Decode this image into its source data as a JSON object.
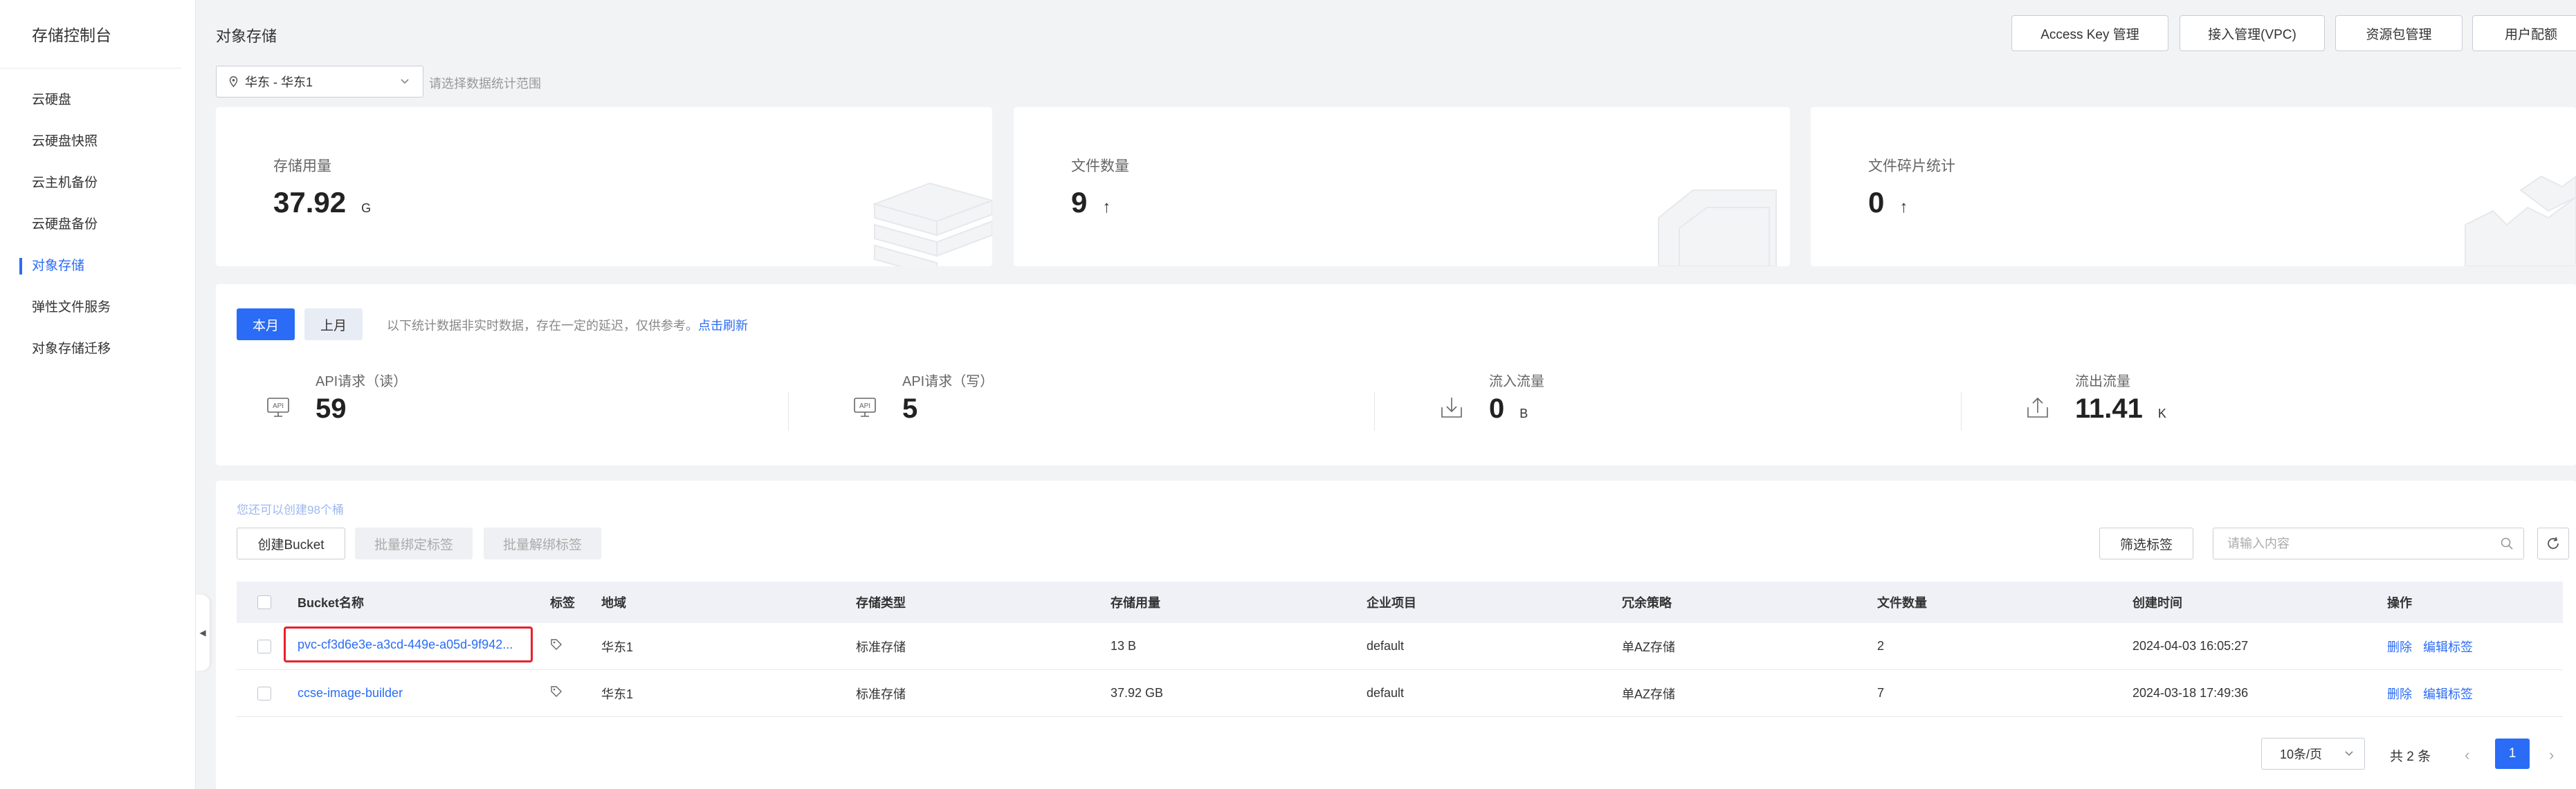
{
  "sidebar": {
    "title": "存储控制台",
    "items": [
      {
        "label": "云硬盘",
        "active": false
      },
      {
        "label": "云硬盘快照",
        "active": false
      },
      {
        "label": "云主机备份",
        "active": false
      },
      {
        "label": "云硬盘备份",
        "active": false
      },
      {
        "label": "对象存储",
        "active": true
      },
      {
        "label": "弹性文件服务",
        "active": false
      },
      {
        "label": "对象存储迁移",
        "active": false
      }
    ]
  },
  "header": {
    "title": "对象存储",
    "buttons": [
      "Access Key 管理",
      "接入管理(VPC)",
      "资源包管理",
      "用户配额"
    ]
  },
  "region": {
    "selected": "华东 - 华东1",
    "hint": "请选择数据统计范围"
  },
  "stats": [
    {
      "label": "存储用量",
      "value": "37.92",
      "unit": "G"
    },
    {
      "label": "文件数量",
      "value": "9",
      "unit": "↑"
    },
    {
      "label": "文件碎片统计",
      "value": "0",
      "unit": "↑"
    }
  ],
  "period": {
    "current": "本月",
    "previous": "上月",
    "notice": "以下统计数据非实时数据，存在一定的延迟，仅供参考。",
    "refresh": "点击刷新",
    "metrics": [
      {
        "label": "API请求（读）",
        "value": "59",
        "unit": "",
        "icon": "api-icon"
      },
      {
        "label": "API请求（写）",
        "value": "5",
        "unit": "",
        "icon": "api-icon"
      },
      {
        "label": "流入流量",
        "value": "0",
        "unit": "B",
        "icon": "download-icon"
      },
      {
        "label": "流出流量",
        "value": "11.41",
        "unit": "K",
        "icon": "upload-icon"
      }
    ]
  },
  "bucket": {
    "quota_text": "您还可以创建98个桶",
    "create_label": "创建Bucket",
    "bind_tags_label": "批量绑定标签",
    "unbind_tags_label": "批量解绑标签",
    "filter_tags_label": "筛选标签",
    "search_placeholder": "请输入内容",
    "columns": [
      "Bucket名称",
      "标签",
      "地域",
      "存储类型",
      "存储用量",
      "企业项目",
      "冗余策略",
      "文件数量",
      "创建时间",
      "操作"
    ],
    "rows": [
      {
        "name": "pvc-cf3d6e3e-a3cd-449e-a05d-9f942...",
        "region": "华东1",
        "storage_type": "标准存储",
        "usage": "13 B",
        "project": "default",
        "redundancy": "单AZ存储",
        "files": "2",
        "created": "2024-04-03 16:05:27",
        "op_delete": "删除",
        "op_edit": "编辑标签",
        "highlighted": true
      },
      {
        "name": "ccse-image-builder",
        "region": "华东1",
        "storage_type": "标准存储",
        "usage": "37.92 GB",
        "project": "default",
        "redundancy": "单AZ存储",
        "files": "7",
        "created": "2024-03-18 17:49:36",
        "op_delete": "删除",
        "op_edit": "编辑标签",
        "highlighted": false
      }
    ]
  },
  "pagination": {
    "page_size": "10条/页",
    "total": "共 2 条",
    "current_page": "1"
  },
  "colors": {
    "accent": "#2a6cf6",
    "highlight": "#e8202a"
  }
}
